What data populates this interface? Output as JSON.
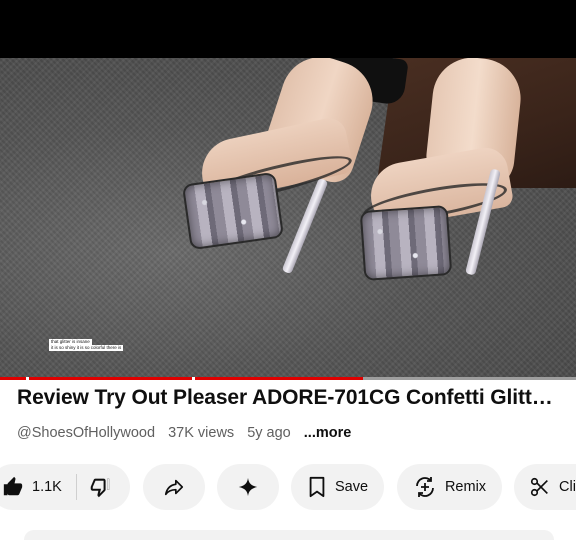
{
  "video": {
    "caption_line1": "that glitter is insane",
    "caption_line2": "it is so shiny it is so colorful there is",
    "progress_fraction": 0.63
  },
  "details": {
    "title": "Review Try Out Pleaser ADORE-701CG Confetti Glitt…",
    "channel": "@ShoesOfHollywood",
    "views": "37K views",
    "age": "5y ago",
    "more_label": "...more"
  },
  "actions": {
    "like_count": "1.1K",
    "save_label": "Save",
    "remix_label": "Remix",
    "clip_label": "Cli",
    "icons": [
      "thumbs-up-icon",
      "thumbs-down-icon",
      "share-icon",
      "sparkle-icon",
      "bookmark-icon",
      "remix-icon",
      "scissors-icon"
    ]
  },
  "colors": {
    "progress": "#e00000",
    "pill_bg": "#f2f2f2",
    "text": "#0f0f0f",
    "meta": "#606060"
  }
}
